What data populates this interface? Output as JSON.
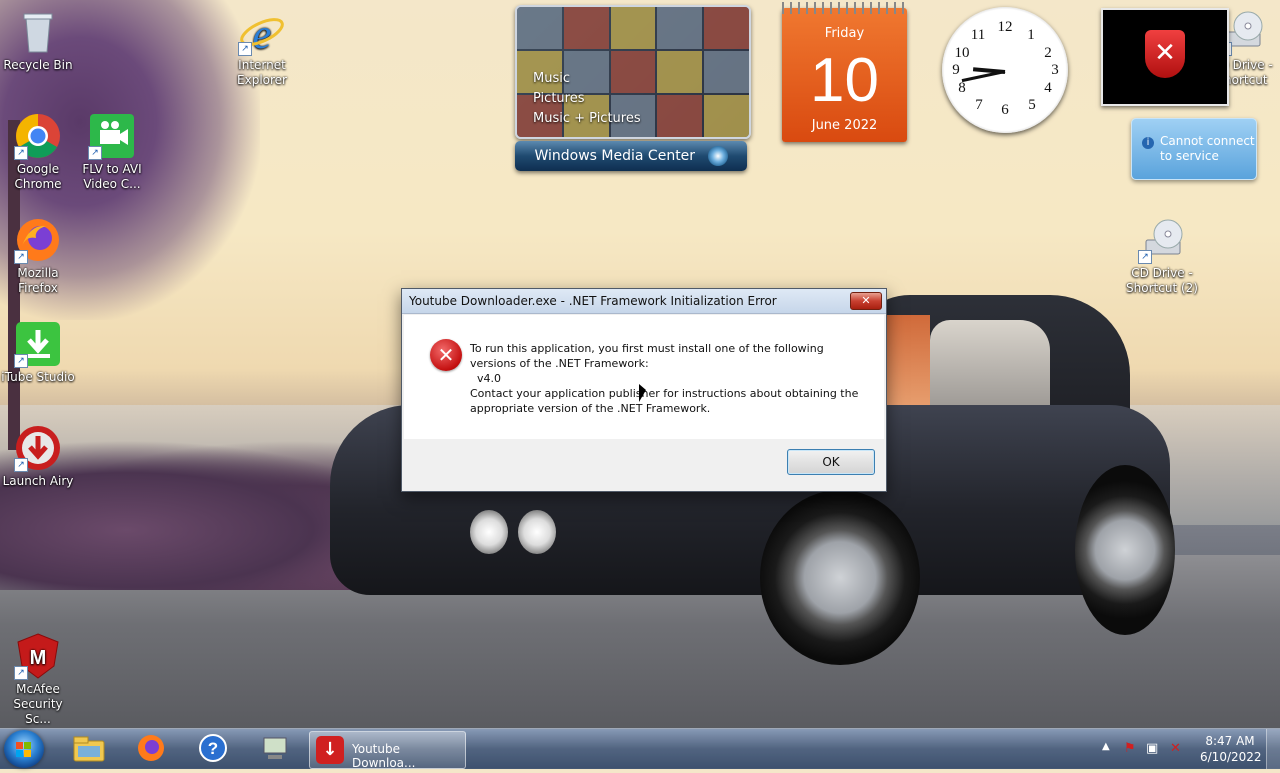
{
  "desktop_icons": [
    {
      "label": "Recycle Bin",
      "icon": "recycle-bin-icon"
    },
    {
      "label": "Internet Explorer",
      "icon": "internet-explorer-icon"
    },
    {
      "label": "Google Chrome",
      "icon": "chrome-icon"
    },
    {
      "label": "FLV to AVI Video C...",
      "icon": "flv-to-avi-icon"
    },
    {
      "label": "Mozilla Firefox",
      "icon": "firefox-icon"
    },
    {
      "label": "iTube Studio",
      "icon": "itube-studio-icon"
    },
    {
      "label": "Launch Airy",
      "icon": "airy-icon"
    },
    {
      "label": "McAfee Security Sc...",
      "icon": "mcafee-icon"
    },
    {
      "label": "CD Drive - Shortcut",
      "icon": "cd-drive-icon"
    },
    {
      "label": "CD Drive - Shortcut (2)",
      "icon": "cd-drive-icon"
    }
  ],
  "gadgets": {
    "media_center": {
      "menu": [
        "Music",
        "Pictures",
        "Music + Pictures"
      ],
      "title": "Windows Media Center"
    },
    "calendar": {
      "weekday": "Friday",
      "day": "10",
      "month_year": "June 2022"
    },
    "clock": {
      "numbers": [
        "12",
        "1",
        "2",
        "3",
        "4",
        "5",
        "6",
        "7",
        "8",
        "9",
        "10",
        "11"
      ]
    },
    "network": {
      "message": "Cannot connect to service"
    }
  },
  "dialog": {
    "title": "Youtube Downloader.exe - .NET Framework Initialization Error",
    "close_label": "✕",
    "message": "To run this application, you first must install one of the following\nversions of the .NET Framework:\n  v4.0\nContact your application publisher for instructions about obtaining the\nappropriate version of the .NET Framework.",
    "ok_label": "OK",
    "icon": "error-icon"
  },
  "taskbar": {
    "pinned": [
      {
        "name": "file-explorer-icon"
      },
      {
        "name": "firefox-icon"
      },
      {
        "name": "help-icon"
      },
      {
        "name": "network-computer-icon"
      }
    ],
    "active_task": "Youtube Downloa...",
    "time": "8:47 AM",
    "date": "6/10/2022"
  }
}
